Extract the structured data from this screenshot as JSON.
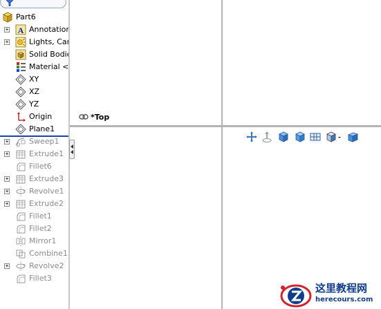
{
  "tree": {
    "root_label": "Part6",
    "items": [
      {
        "label": "Annotations",
        "icon": "annotations-icon",
        "expandable": true,
        "state": "active"
      },
      {
        "label": "Lights, Cam",
        "icon": "lights-cameras-icon",
        "expandable": true,
        "state": "active"
      },
      {
        "label": "Solid Bodies",
        "icon": "solid-bodies-icon",
        "expandable": false,
        "state": "active"
      },
      {
        "label": "Material <n",
        "icon": "material-icon",
        "expandable": false,
        "state": "active"
      },
      {
        "label": "XY",
        "icon": "plane-icon",
        "expandable": false,
        "state": "active"
      },
      {
        "label": "XZ",
        "icon": "plane-icon",
        "expandable": false,
        "state": "active"
      },
      {
        "label": "YZ",
        "icon": "plane-icon",
        "expandable": false,
        "state": "active"
      },
      {
        "label": "Origin",
        "icon": "origin-icon",
        "expandable": false,
        "state": "active"
      },
      {
        "label": "Plane1",
        "icon": "plane-icon",
        "expandable": false,
        "state": "active"
      },
      {
        "label": "Sweep1",
        "icon": "sweep-icon",
        "expandable": true,
        "state": "suppressed"
      },
      {
        "label": "Extrude1",
        "icon": "extrude-icon",
        "expandable": true,
        "state": "suppressed"
      },
      {
        "label": "Fillet6",
        "icon": "fillet-icon",
        "expandable": false,
        "state": "suppressed"
      },
      {
        "label": "Extrude3",
        "icon": "extrude-icon",
        "expandable": true,
        "state": "suppressed"
      },
      {
        "label": "Revolve1",
        "icon": "revolve-icon",
        "expandable": true,
        "state": "suppressed"
      },
      {
        "label": "Extrude2",
        "icon": "extrude-icon",
        "expandable": true,
        "state": "suppressed"
      },
      {
        "label": "Fillet1",
        "icon": "fillet-icon",
        "expandable": false,
        "state": "suppressed"
      },
      {
        "label": "Fillet2",
        "icon": "fillet-icon",
        "expandable": false,
        "state": "suppressed"
      },
      {
        "label": "Mirror1",
        "icon": "mirror-icon",
        "expandable": false,
        "state": "suppressed"
      },
      {
        "label": "Combine1",
        "icon": "combine-icon",
        "expandable": false,
        "state": "suppressed"
      },
      {
        "label": "Revolve2",
        "icon": "revolve-icon",
        "expandable": true,
        "state": "suppressed"
      },
      {
        "label": "Fillet3",
        "icon": "fillet-icon",
        "expandable": false,
        "state": "suppressed"
      }
    ]
  },
  "viewport": {
    "active_view_label": "*Top",
    "toolbar": [
      {
        "name": "pan-icon"
      },
      {
        "name": "move-icon"
      },
      {
        "name": "view-cube-icon"
      },
      {
        "name": "display-cube-icon"
      },
      {
        "name": "section-view-icon"
      },
      {
        "name": "view-orientation-icon"
      },
      {
        "name": "display-style-icon"
      }
    ]
  },
  "watermark": {
    "title": "这里教程网",
    "url": "herecours.com"
  },
  "colors": {
    "rollback_bar": "#1f3ea6",
    "watermark_blue": "#103e8c",
    "watermark_red": "#d2232a"
  }
}
